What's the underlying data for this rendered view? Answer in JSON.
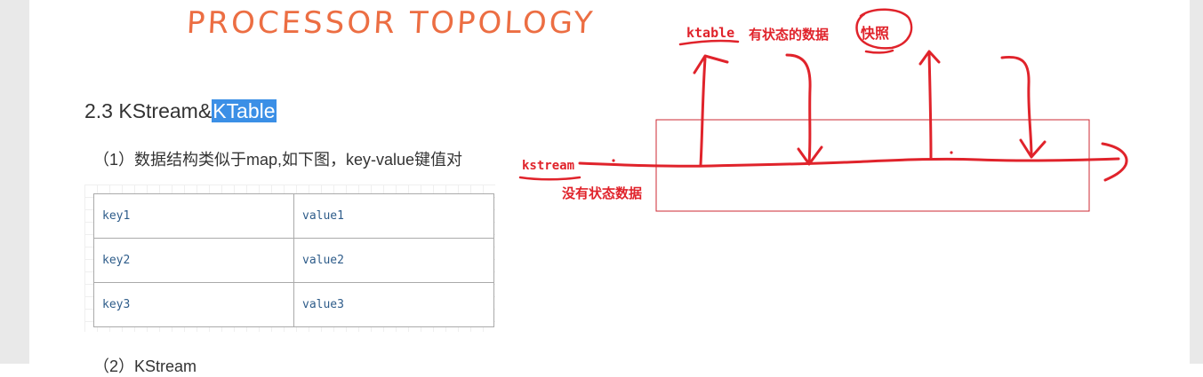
{
  "document": {
    "banner": "PROCESSOR TOPOLOGY",
    "heading_prefix": "2.3 KStream&",
    "heading_highlight": "KTable",
    "paragraph_1": "（1）数据结构类似于map,如下图，key-value键值对",
    "table": [
      {
        "key": "key1",
        "value": "value1"
      },
      {
        "key": "key2",
        "value": "value2"
      },
      {
        "key": "key3",
        "value": "value3"
      }
    ],
    "paragraph_2": "（2）KStream"
  },
  "annotations": {
    "ktable_label": "ktable",
    "ktable_desc": "有状态的数据",
    "snapshot": "快照",
    "kstream_label": "kstream",
    "kstream_desc": "没有状态数据",
    "ink_color": "#e0232b",
    "highlight_color": "#3b8fe6"
  }
}
